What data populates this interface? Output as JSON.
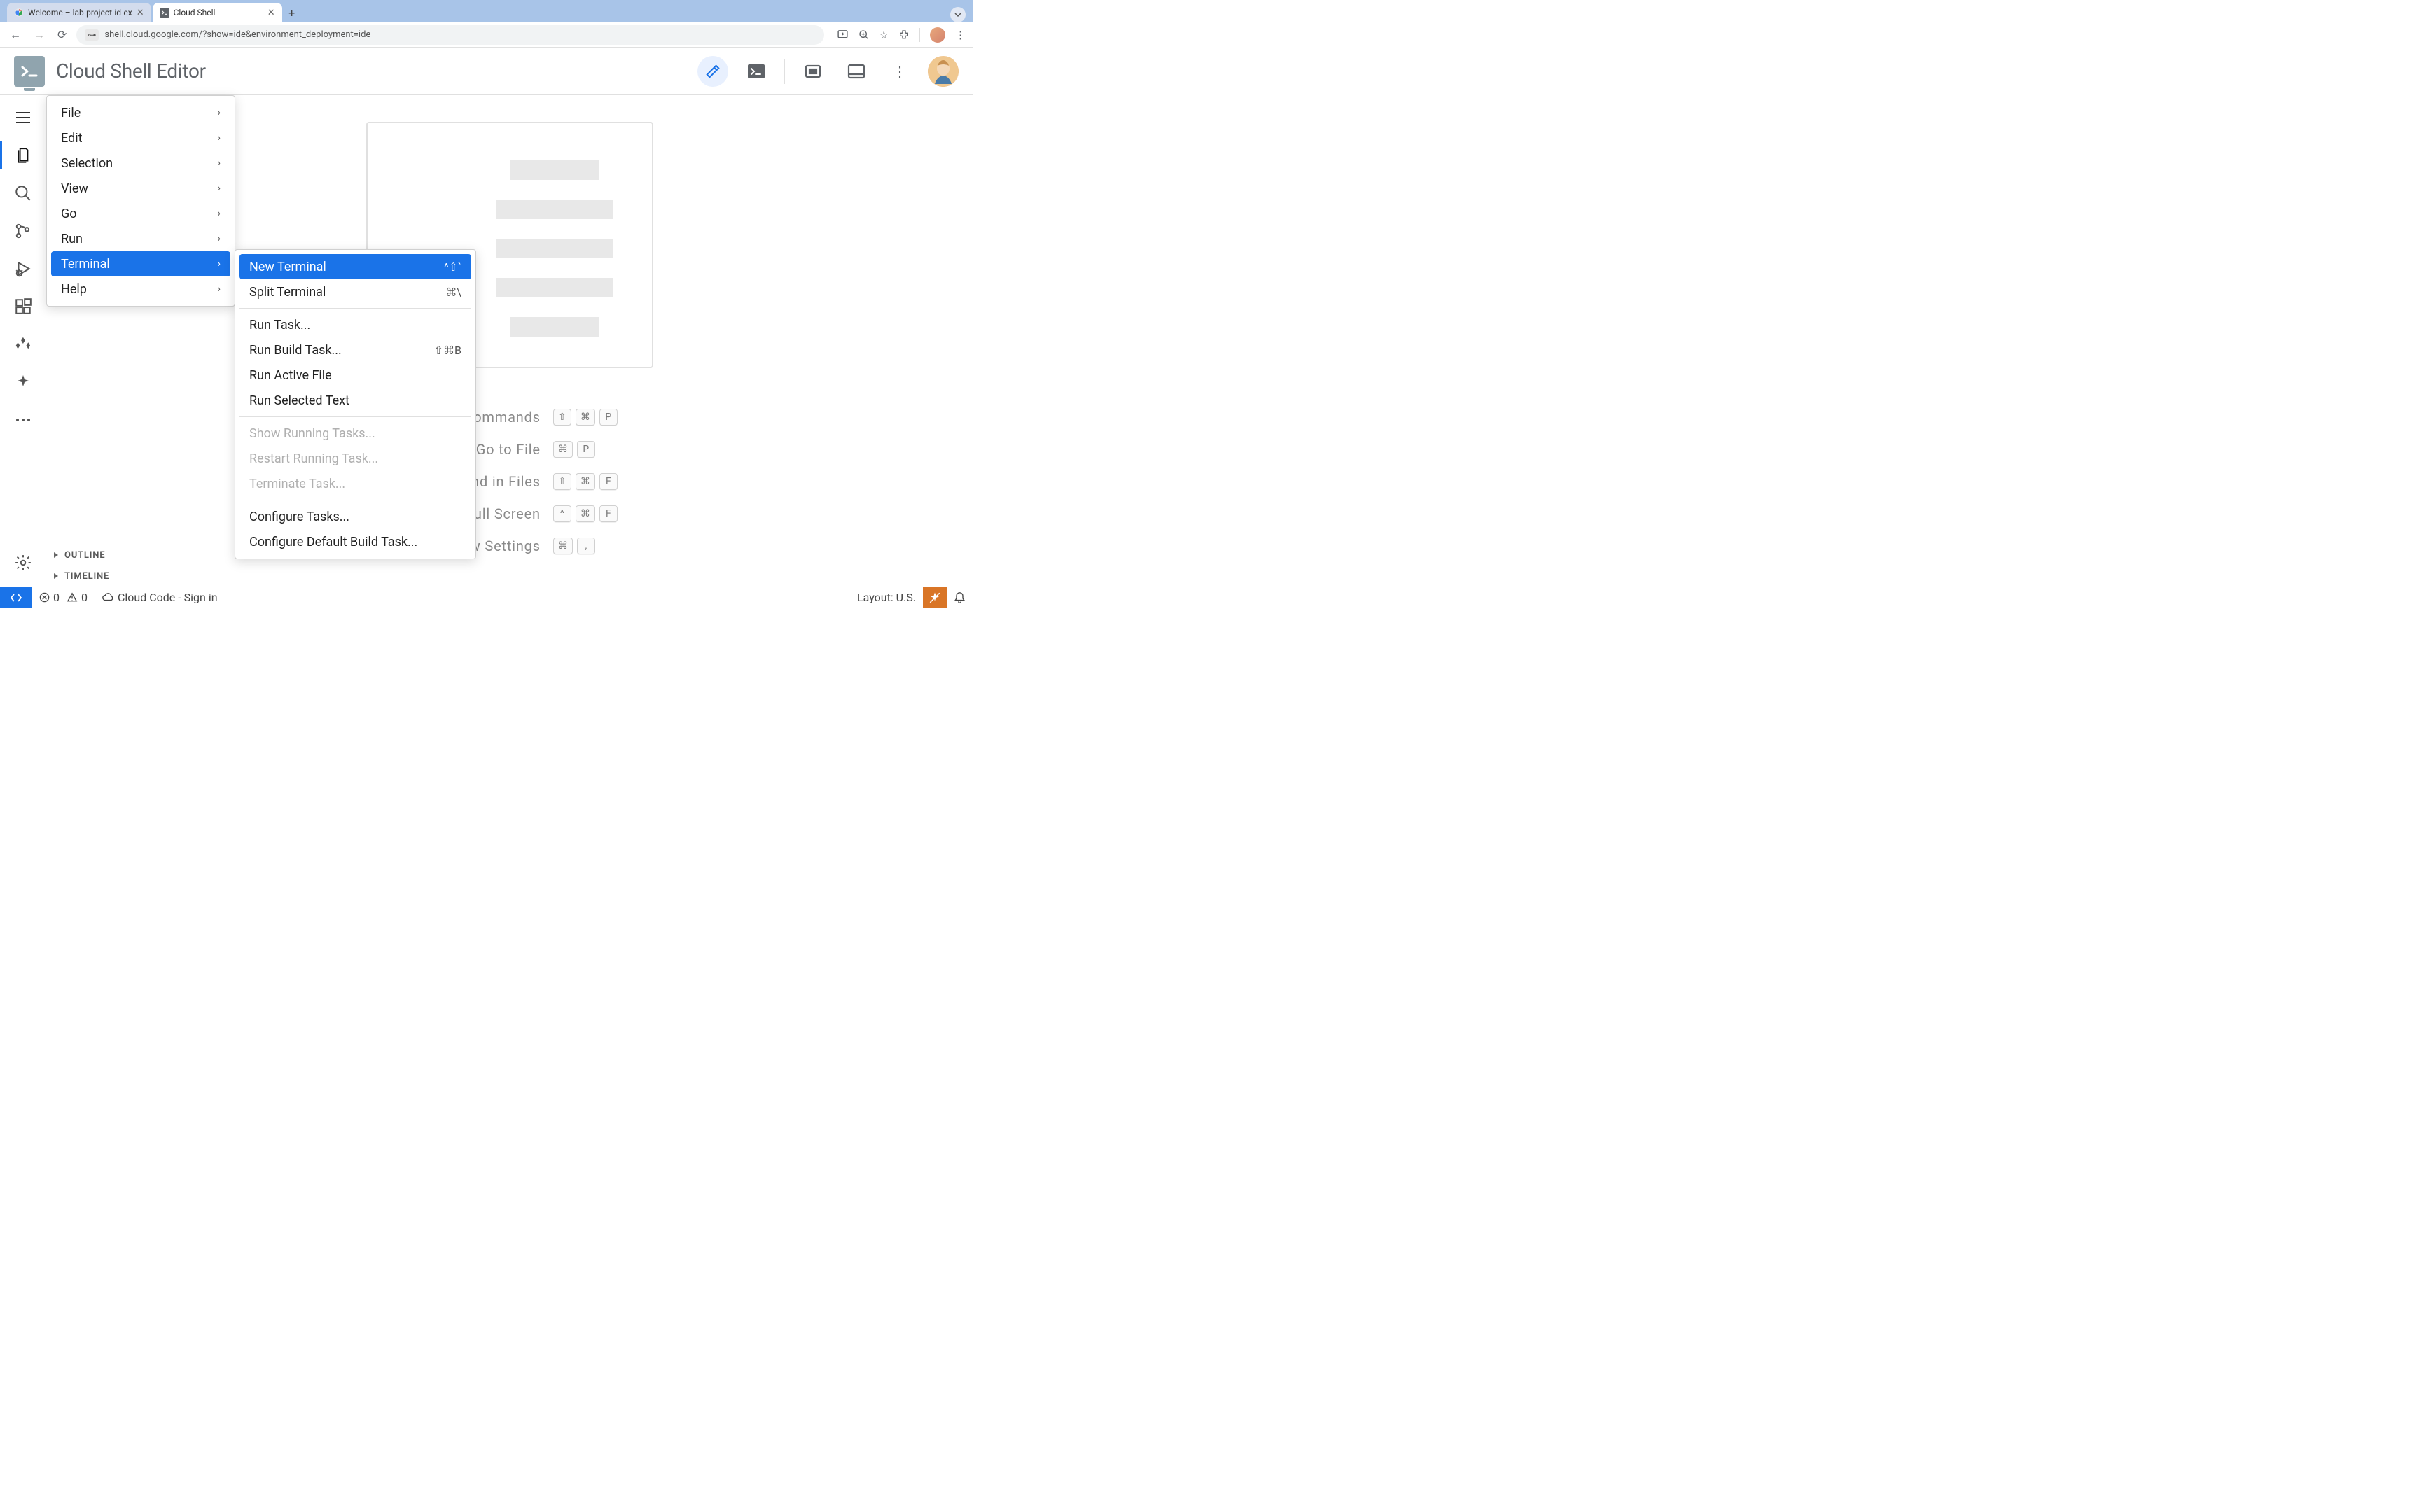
{
  "browser": {
    "tabs": [
      {
        "title": "Welcome – lab-project-id-ex",
        "active": false
      },
      {
        "title": "Cloud Shell",
        "active": true
      }
    ],
    "url": "shell.cloud.google.com/?show=ide&environment_deployment=ide"
  },
  "app": {
    "title": "Cloud Shell Editor"
  },
  "menu": {
    "items": [
      "File",
      "Edit",
      "Selection",
      "View",
      "Go",
      "Run",
      "Terminal",
      "Help"
    ],
    "highlighted": "Terminal"
  },
  "submenu": {
    "items": [
      {
        "label": "New Terminal",
        "shortcut": "^⇧`",
        "highlight": true
      },
      {
        "label": "Split Terminal",
        "shortcut": "⌘\\"
      }
    ],
    "group2": [
      {
        "label": "Run Task..."
      },
      {
        "label": "Run Build Task...",
        "shortcut": "⇧⌘B"
      },
      {
        "label": "Run Active File"
      },
      {
        "label": "Run Selected Text"
      }
    ],
    "group3": [
      {
        "label": "Show Running Tasks...",
        "disabled": true
      },
      {
        "label": "Restart Running Task...",
        "disabled": true
      },
      {
        "label": "Terminate Task...",
        "disabled": true
      }
    ],
    "group4": [
      {
        "label": "Configure Tasks..."
      },
      {
        "label": "Configure Default Build Task..."
      }
    ]
  },
  "commands": [
    {
      "label": "Show All Commands",
      "keys": [
        "⇧",
        "⌘",
        "P"
      ]
    },
    {
      "label": "Go to File",
      "keys": [
        "⌘",
        "P"
      ]
    },
    {
      "label": "Find in Files",
      "keys": [
        "⇧",
        "⌘",
        "F"
      ]
    },
    {
      "label": "Toggle Full Screen",
      "keys": [
        "^",
        "⌘",
        "F"
      ]
    },
    {
      "label": "Show Settings",
      "keys": [
        "⌘",
        ","
      ]
    }
  ],
  "sidebar_panels": [
    "OUTLINE",
    "TIMELINE"
  ],
  "status": {
    "errors": "0",
    "warnings": "0",
    "cloud_code": "Cloud Code - Sign in",
    "layout": "Layout: U.S."
  }
}
